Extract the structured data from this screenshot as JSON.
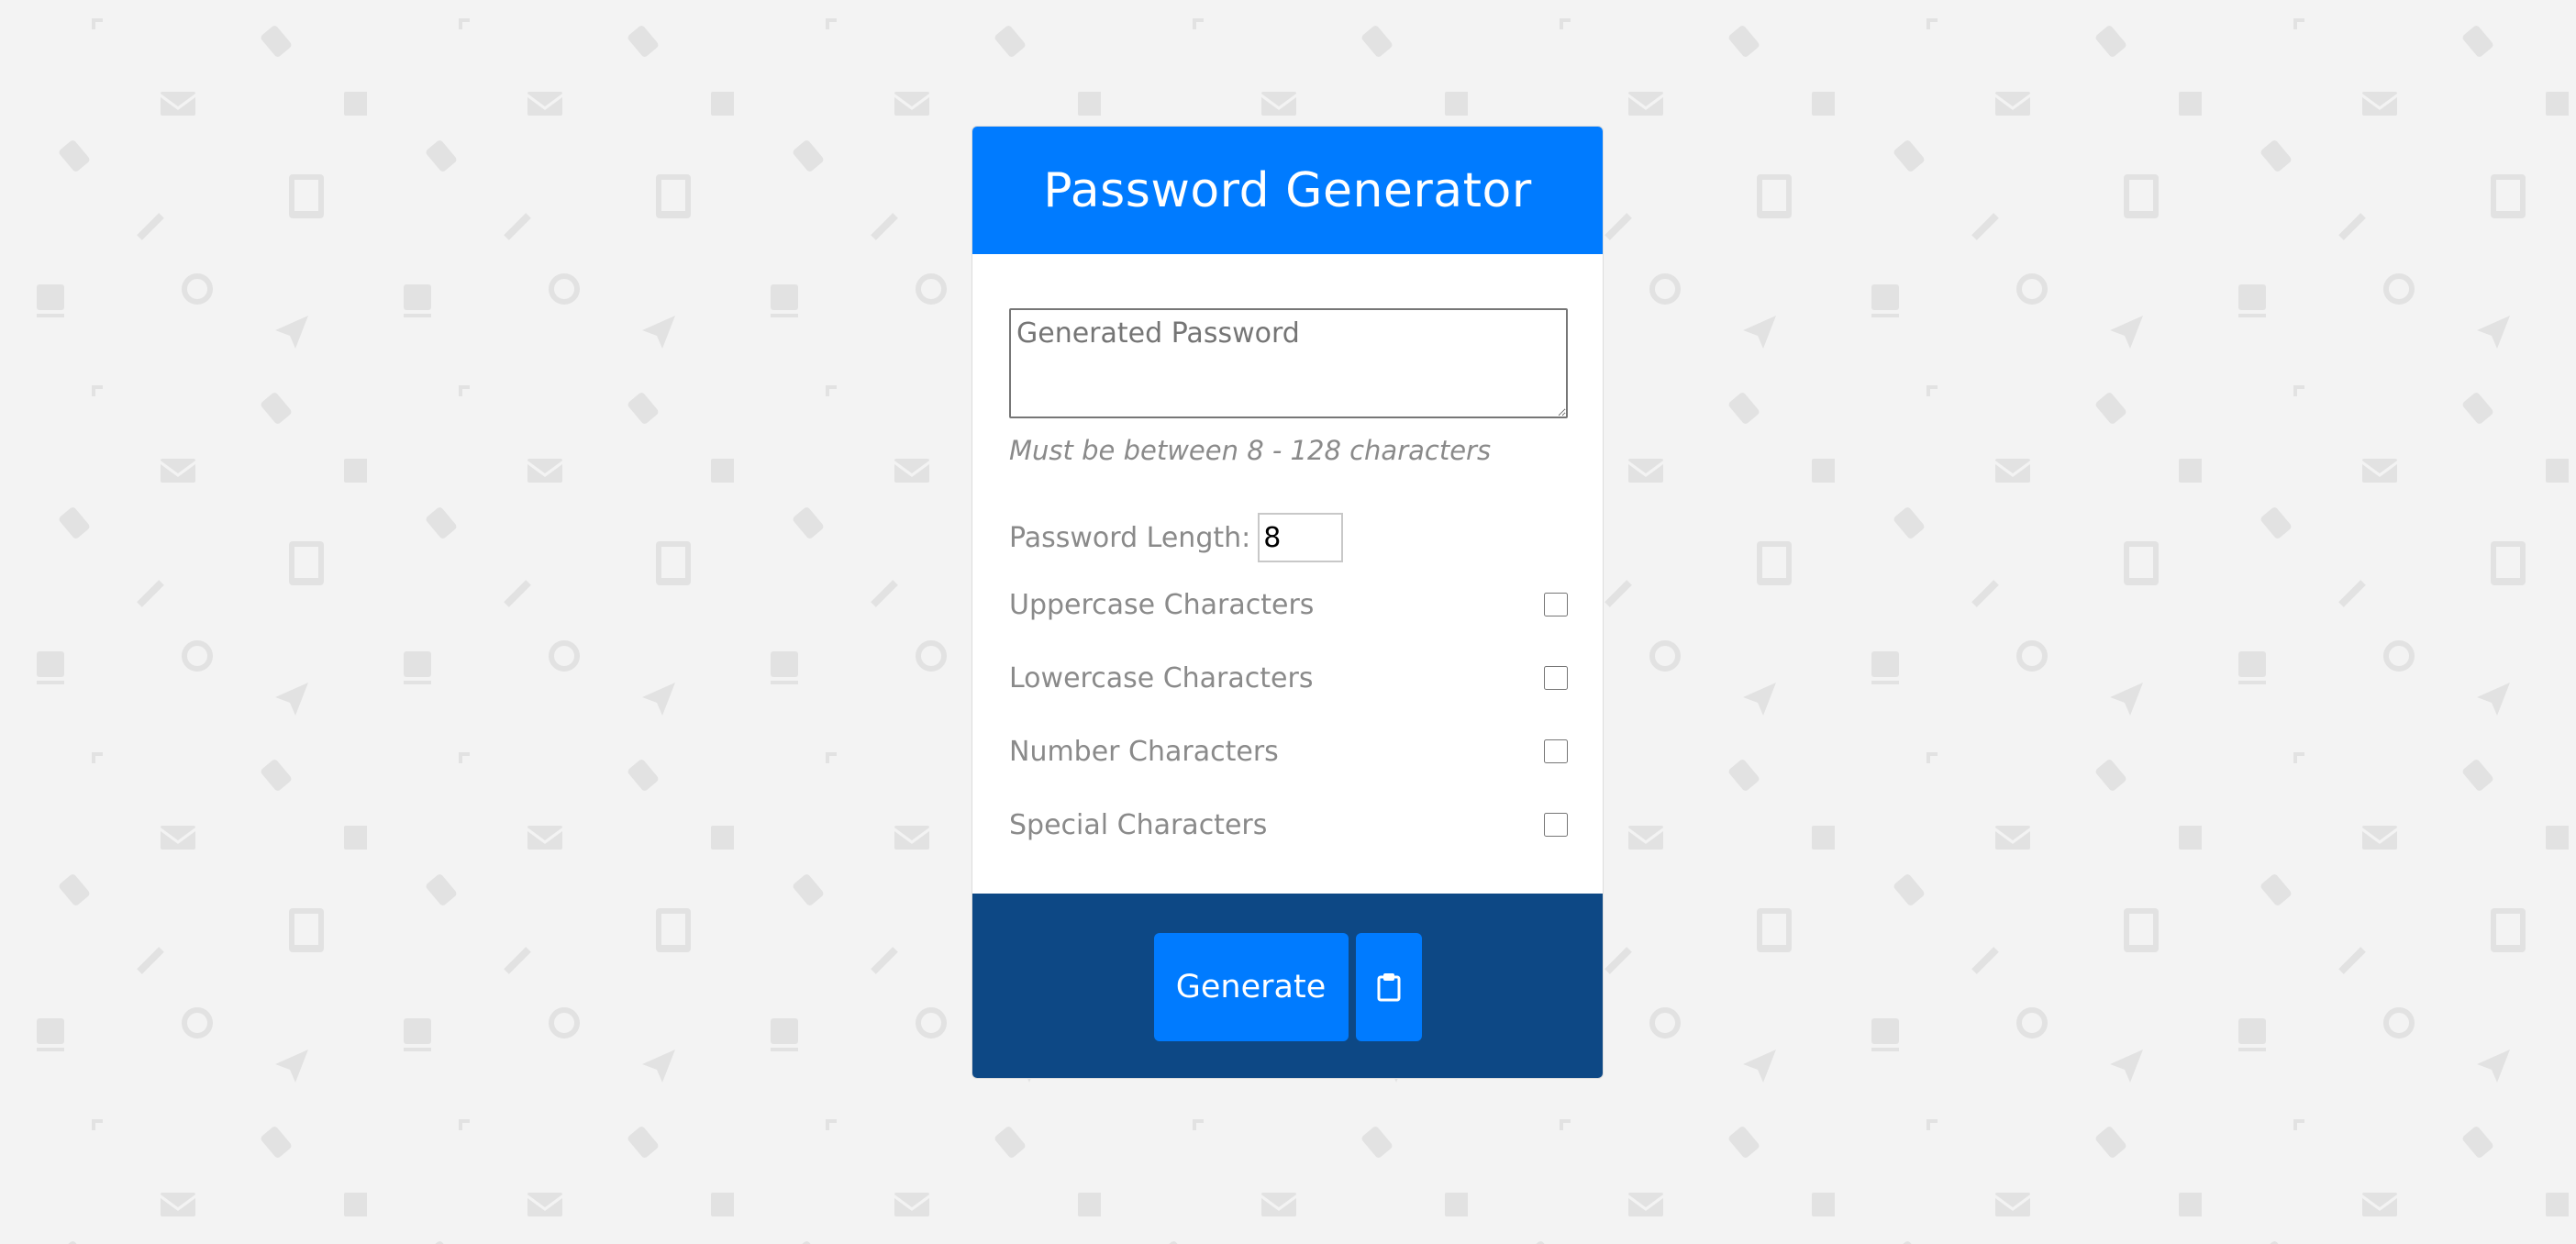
{
  "header": {
    "title": "Password Generator"
  },
  "password": {
    "placeholder": "Generated Password",
    "value": ""
  },
  "hint": "Must be between 8 - 128 characters",
  "length": {
    "label": "Password Length:",
    "value": "8"
  },
  "options": [
    {
      "label": "Uppercase Characters",
      "checked": false
    },
    {
      "label": "Lowercase Characters",
      "checked": false
    },
    {
      "label": "Number Characters",
      "checked": false
    },
    {
      "label": "Special Characters",
      "checked": false
    }
  ],
  "footer": {
    "generate_label": "Generate",
    "copy_icon": "clipboard-icon"
  },
  "colors": {
    "header_bg": "#007bff",
    "footer_bg": "#0d4885",
    "button_bg": "#007bff",
    "page_bg": "#f3f3f3"
  }
}
